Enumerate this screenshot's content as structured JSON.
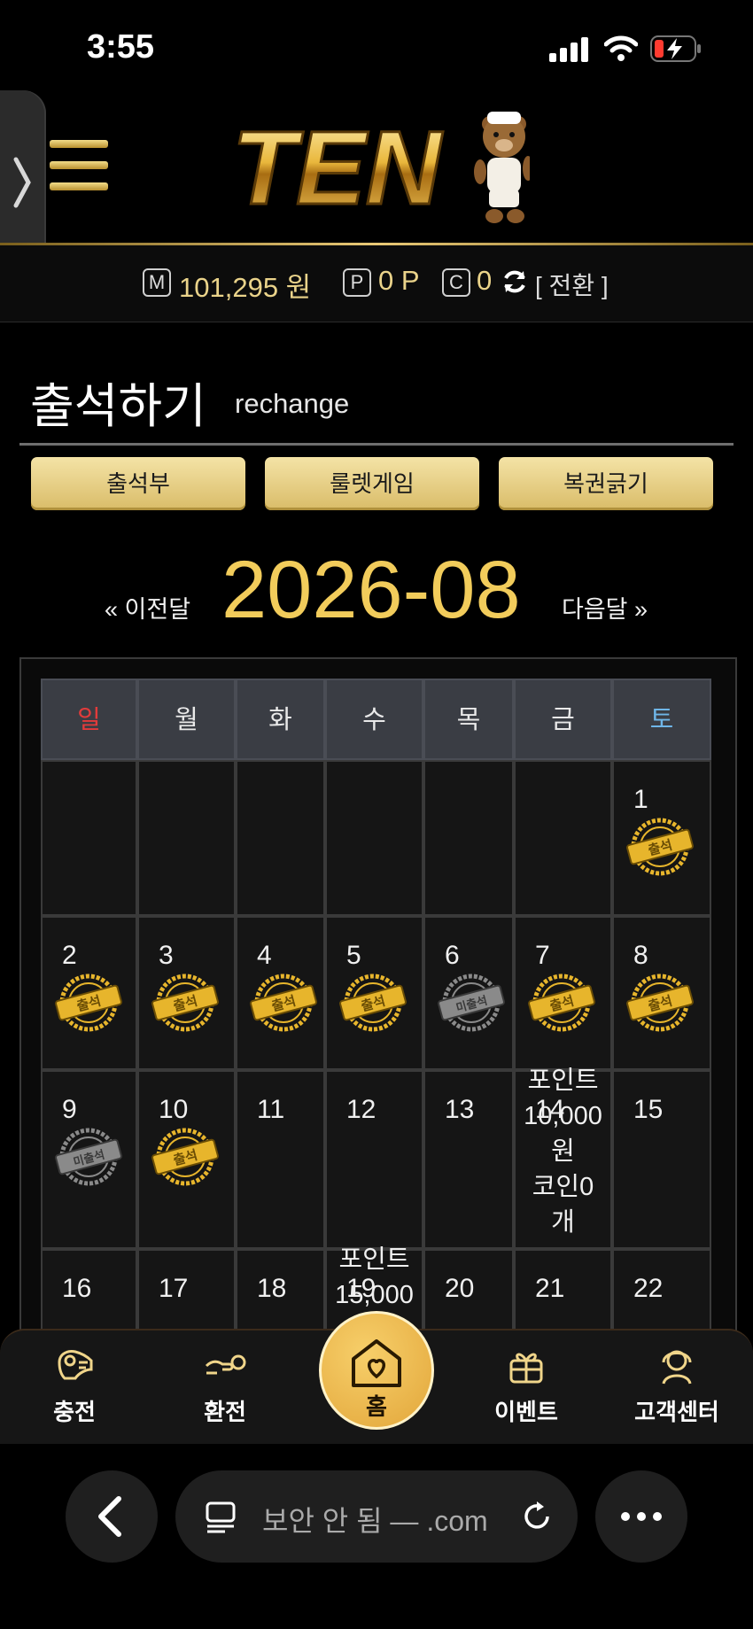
{
  "status": {
    "time": "3:55"
  },
  "header": {
    "logo_text": "TEN",
    "balance": {
      "money_badge": "M",
      "money": "101,295 원",
      "point_badge": "P",
      "point": "0 P",
      "coin_badge": "C",
      "coin": "0",
      "switch_label": "[ 전환 ]"
    }
  },
  "page": {
    "title": "출석하기",
    "subtitle": "rechange"
  },
  "tabs": [
    "출석부",
    "룰렛게임",
    "복권긁기"
  ],
  "month_nav": {
    "prev": "« 이전달",
    "current": "2026-08",
    "next": "다음달 »"
  },
  "calendar": {
    "weekdays": [
      "일",
      "월",
      "화",
      "수",
      "목",
      "금",
      "토"
    ],
    "weekday_colors": {
      "sunday": "#e23b3b",
      "saturday": "#6fb6e8",
      "weekday": "#e9e9e9"
    },
    "stamp_attended": "출석",
    "stamp_absent": "미출석",
    "rows": [
      [
        null,
        null,
        null,
        null,
        null,
        null,
        {
          "day": "1",
          "stamp": "attended"
        }
      ],
      [
        {
          "day": "2",
          "stamp": "attended"
        },
        {
          "day": "3",
          "stamp": "attended"
        },
        {
          "day": "4",
          "stamp": "attended"
        },
        {
          "day": "5",
          "stamp": "attended"
        },
        {
          "day": "6",
          "stamp": "absent"
        },
        {
          "day": "7",
          "stamp": "attended"
        },
        {
          "day": "8",
          "stamp": "attended"
        }
      ],
      [
        {
          "day": "9",
          "stamp": "absent"
        },
        {
          "day": "10",
          "stamp": "attended"
        },
        {
          "day": "11"
        },
        {
          "day": "12"
        },
        {
          "day": "13"
        },
        {
          "day": "14",
          "note": [
            "포인트",
            "10,000",
            "원",
            "코인0",
            "개"
          ]
        },
        {
          "day": "15"
        }
      ],
      [
        {
          "day": "16"
        },
        {
          "day": "17"
        },
        {
          "day": "18"
        },
        {
          "day": "19",
          "note": [
            "포인트",
            "15,000"
          ]
        },
        {
          "day": "20"
        },
        {
          "day": "21"
        },
        {
          "day": "22"
        }
      ]
    ]
  },
  "bottom_nav": {
    "items": [
      {
        "label": "충전",
        "icon": "charge-icon"
      },
      {
        "label": "환전",
        "icon": "exchange-icon"
      },
      {
        "label": "홈",
        "icon": "home-icon"
      },
      {
        "label": "이벤트",
        "icon": "gift-icon"
      },
      {
        "label": "고객센터",
        "icon": "support-icon"
      }
    ]
  },
  "browser": {
    "address": "보안 안 됨 — .com"
  },
  "colors": {
    "gold": "#f2cc5b",
    "button_gold": "#e6cd83",
    "background": "#000000"
  }
}
